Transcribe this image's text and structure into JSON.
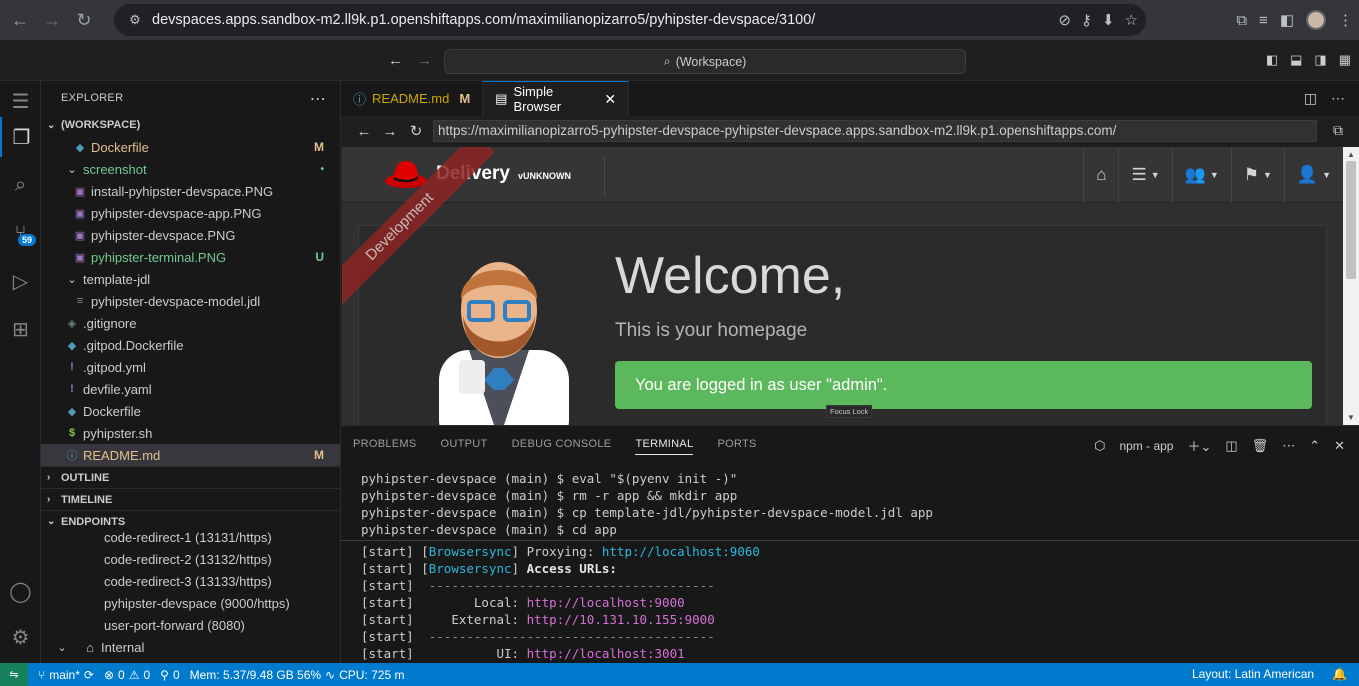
{
  "browser": {
    "url": "devspaces.apps.sandbox-m2.ll9k.p1.openshiftapps.com/maximilianopizarro5/pyhipster-devspace/3100/"
  },
  "titlebar": {
    "command_center": "(Workspace)"
  },
  "activity": {
    "scm_badge": "59"
  },
  "explorer": {
    "header": "EXPLORER",
    "workspace_label": "(WORKSPACE)",
    "items": [
      {
        "label": "Dockerfile",
        "status": "M",
        "kind": "docker"
      },
      {
        "label": "screenshot",
        "status": "•",
        "kind": "folder"
      },
      {
        "label": "install-pyhipster-devspace.PNG",
        "status": "",
        "kind": "img"
      },
      {
        "label": "pyhipster-devspace-app.PNG",
        "status": "",
        "kind": "img"
      },
      {
        "label": "pyhipster-devspace.PNG",
        "status": "",
        "kind": "img"
      },
      {
        "label": "pyhipster-terminal.PNG",
        "status": "U",
        "kind": "img"
      },
      {
        "label": "template-jdl",
        "status": "",
        "kind": "folder"
      },
      {
        "label": "pyhipster-devspace-model.jdl",
        "status": "",
        "kind": "file"
      },
      {
        "label": ".gitignore",
        "status": "",
        "kind": "git"
      },
      {
        "label": ".gitpod.Dockerfile",
        "status": "",
        "kind": "docker"
      },
      {
        "label": ".gitpod.yml",
        "status": "",
        "kind": "yml"
      },
      {
        "label": "devfile.yaml",
        "status": "",
        "kind": "yml"
      },
      {
        "label": "Dockerfile",
        "status": "",
        "kind": "docker"
      },
      {
        "label": "pyhipster.sh",
        "status": "",
        "kind": "sh"
      },
      {
        "label": "README.md",
        "status": "M",
        "kind": "info"
      }
    ],
    "sections": {
      "outline": "OUTLINE",
      "timeline": "TIMELINE",
      "endpoints": "ENDPOINTS"
    },
    "endpoints": [
      "code-redirect-1 (13131/https)",
      "code-redirect-2 (13132/https)",
      "code-redirect-3 (13133/https)",
      "pyhipster-devspace (9000/https)",
      "user-port-forward (8080)"
    ],
    "internal_label": "Internal"
  },
  "tabs": {
    "readme": "README.md",
    "readme_status": "M",
    "browser": "Simple Browser"
  },
  "simple_browser": {
    "url": "https://maximilianopizarro5-pyhipster-devspace-pyhipster-devspace.apps.sandbox-m2.ll9k.p1.openshiftapps.com/"
  },
  "webapp": {
    "brand": "Delivery",
    "version": "vUNKNOWN",
    "ribbon": "Development",
    "welcome": "Welcome,",
    "subtitle": "This is your homepage",
    "alert": "You are logged in as user \"admin\".",
    "focus_lock": "Focus Lock"
  },
  "panel": {
    "tabs": [
      "PROBLEMS",
      "OUTPUT",
      "DEBUG CONSOLE",
      "TERMINAL",
      "PORTS"
    ],
    "terminal_name": "npm - app",
    "commands": [
      "pyhipster-devspace (main) $ eval \"$(pyenv init -)\"",
      "pyhipster-devspace (main) $ rm -r app && mkdir app",
      "pyhipster-devspace (main) $ cp template-jdl/pyhipster-devspace-model.jdl app",
      "pyhipster-devspace (main) $ cd app"
    ],
    "output": {
      "start": "[start]",
      "browsersync": "Browsersync",
      "proxying": "Proxying:",
      "proxy_url": "http://localhost:9060",
      "access": "Access URLs:",
      "dashes": "--------------------------------------",
      "local_label": "Local:",
      "local_url": "http://localhost:9000",
      "external_label": "External:",
      "external_url": "http://10.131.10.155:9000",
      "ui_label": "UI:",
      "ui_url": "http://localhost:3001"
    }
  },
  "statusbar": {
    "branch": "main*",
    "errors": "0",
    "warnings": "0",
    "ports": "0",
    "mem": "Mem: 5.37/9.48 GB 56%",
    "cpu": "CPU: 725 m",
    "layout": "Layout: Latin American"
  }
}
